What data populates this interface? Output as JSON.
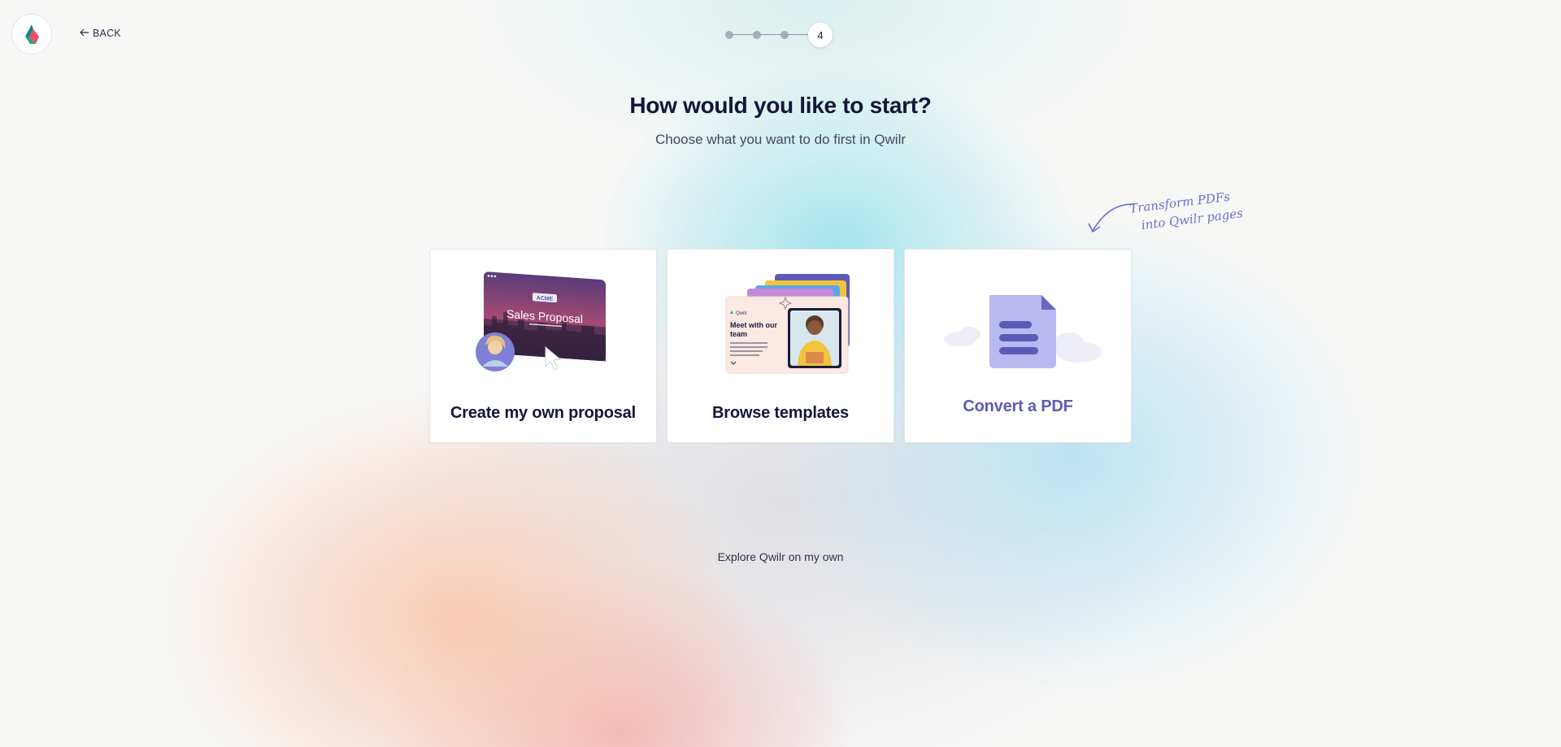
{
  "nav": {
    "back_label": "BACK"
  },
  "stepper": {
    "total_steps": 4,
    "current_step_label": "4"
  },
  "header": {
    "title": "How would you like to start?",
    "subtitle": "Choose what you want to do first in Qwilr"
  },
  "cards": [
    {
      "label": "Create my own proposal",
      "illustration_title": "Sales Proposal",
      "illustration_badge": "ACME",
      "icon": "sales-proposal-illustration"
    },
    {
      "label": "Browse templates",
      "illustration_brand": "Qwilr",
      "illustration_heading": "Meet with our team",
      "icon": "templates-illustration"
    },
    {
      "label": "Convert a PDF",
      "icon": "pdf-document-icon"
    }
  ],
  "annotation": {
    "line1": "Transform PDFs",
    "line2": "into Qwilr pages"
  },
  "footer": {
    "explore_label": "Explore Qwilr on my own"
  },
  "colors": {
    "brand_dark": "#14163a",
    "accent_purple": "#5b5bb5",
    "pdf_icon": "#b9b8f0"
  }
}
